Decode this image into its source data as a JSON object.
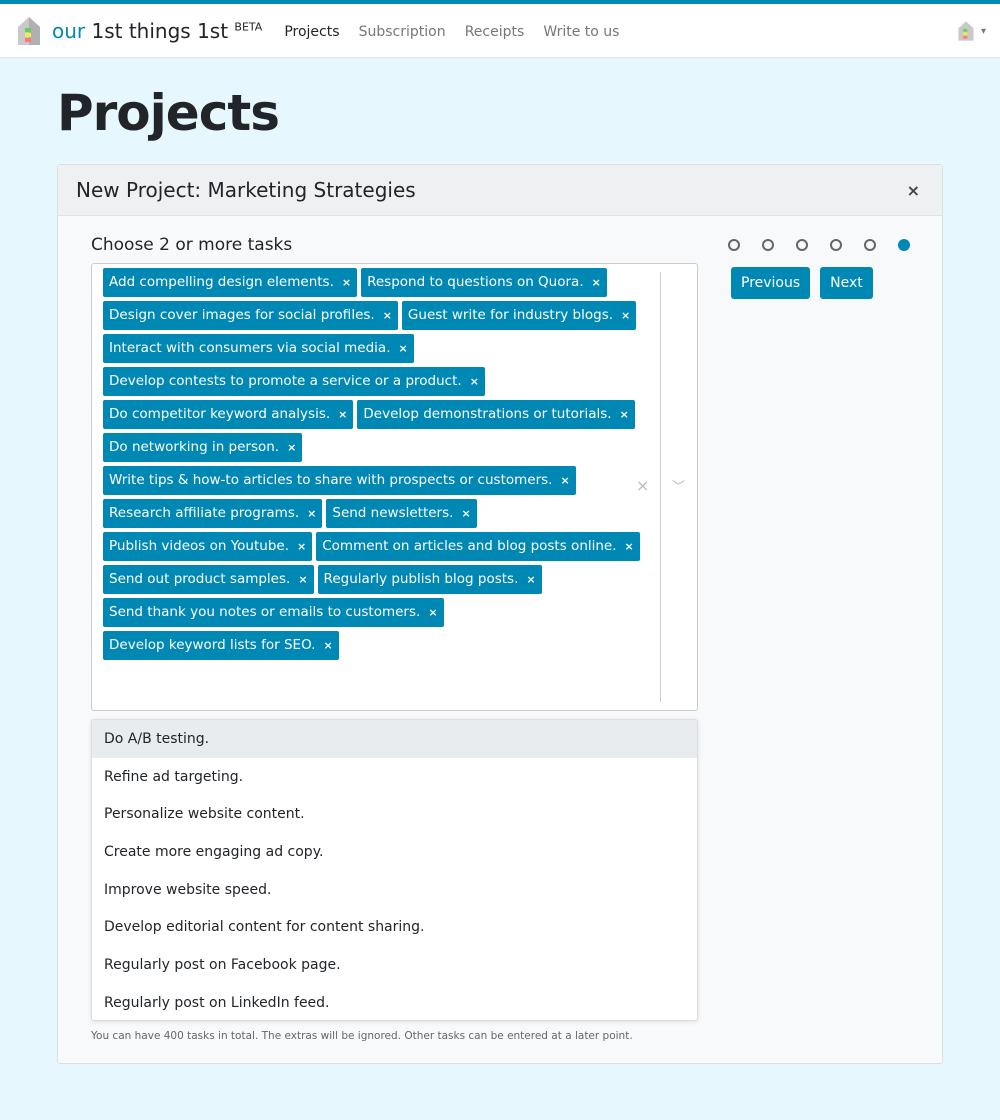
{
  "nav": {
    "brand_prefix": "our",
    "brand_name": "1st things 1st",
    "brand_badge": "BETA",
    "links": [
      "Projects",
      "Subscription",
      "Receipts",
      "Write to us"
    ],
    "active": "Projects",
    "user_caret": "▾"
  },
  "page_title": "Projects",
  "card": {
    "title": "New Project: Marketing Strategies",
    "close": "×",
    "label": "Choose 2 or more tasks",
    "steps": {
      "total": 6,
      "current": 6
    },
    "previous": "Previous",
    "next": "Next",
    "selected_tags": [
      "Add compelling design elements.",
      "Respond to questions on Quora.",
      "Design cover images for social profiles.",
      "Guest write for industry blogs.",
      "Interact with consumers via social media.",
      "Develop contests to promote a service or a product.",
      "Do competitor keyword analysis.",
      "Develop demonstrations or tutorials.",
      "Do networking in person.",
      "Write tips & how-to articles to share with prospects or customers.",
      "Research affiliate programs.",
      "Send newsletters.",
      "Publish videos on Youtube.",
      "Comment on articles and blog posts online.",
      "Send out product samples.",
      "Regularly publish blog posts.",
      "Send thank you notes or emails to customers.",
      "Develop keyword lists for SEO."
    ],
    "tag_remove": "×",
    "clear_all": "×",
    "dropdown": "⌄",
    "options": [
      "Do A/B testing.",
      "Refine ad targeting.",
      "Personalize website content.",
      "Create more engaging ad copy.",
      "Improve website speed.",
      "Develop editorial content for content sharing.",
      "Regularly post on Facebook page.",
      "Regularly post on LinkedIn feed."
    ],
    "help": "You can have 400 tasks in total. The extras will be ignored. Other tasks can be entered at a later point."
  },
  "colors": {
    "accent": "#0088b5",
    "background": "#e6f7fe"
  }
}
